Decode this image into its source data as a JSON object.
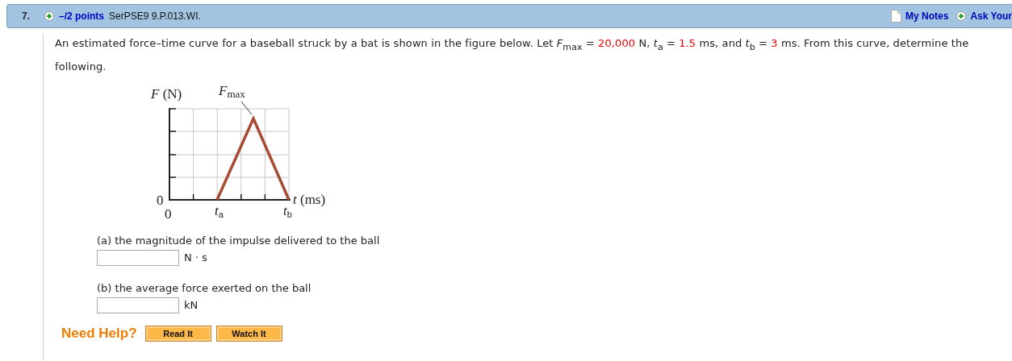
{
  "header": {
    "number": "7.",
    "points": "–/2 points",
    "problem_id": "SerPSE9 9.P.013.WI.",
    "links": [
      {
        "kind": "notes",
        "label": "My Notes"
      },
      {
        "kind": "ask",
        "label": "Ask Your"
      }
    ]
  },
  "intro": [
    {
      "kind": "text",
      "text": "An estimated force–time curve for a baseball struck by a bat is shown in the figure below. Let *F*$_{max}$ = "
    },
    {
      "kind": "value",
      "text": "20,000"
    },
    {
      "kind": "text",
      "text": " N, *t*$_{a}$ = "
    },
    {
      "kind": "value",
      "text": "1.5"
    },
    {
      "kind": "text",
      "text": " ms, and *t*$_{b}$ = "
    },
    {
      "kind": "value",
      "text": "3"
    },
    {
      "kind": "text",
      "text": " ms. From this curve, determine the following."
    }
  ],
  "figure": {
    "labels": [
      {
        "kind": "y_axis",
        "text": "*F* (N)"
      },
      {
        "kind": "peak",
        "text": "*F*$_{max}$"
      },
      {
        "kind": "y_zero",
        "text": "0"
      },
      {
        "kind": "x_zero",
        "text": "0"
      },
      {
        "kind": "t_a",
        "text": "*t*$_{a}$"
      },
      {
        "kind": "t_b",
        "text": "*t*$_{b}$"
      },
      {
        "kind": "x_axis",
        "text": "*t* (ms)"
      }
    ]
  },
  "parts": [
    {
      "question": "(a) the magnitude of the impulse delivered to the ball",
      "unit": "N · s"
    },
    {
      "question": "(b) the average force exerted on the ball",
      "unit": "kN"
    }
  ],
  "help": {
    "label": "Need Help?",
    "buttons": [
      "Read It",
      "Watch It"
    ]
  }
}
